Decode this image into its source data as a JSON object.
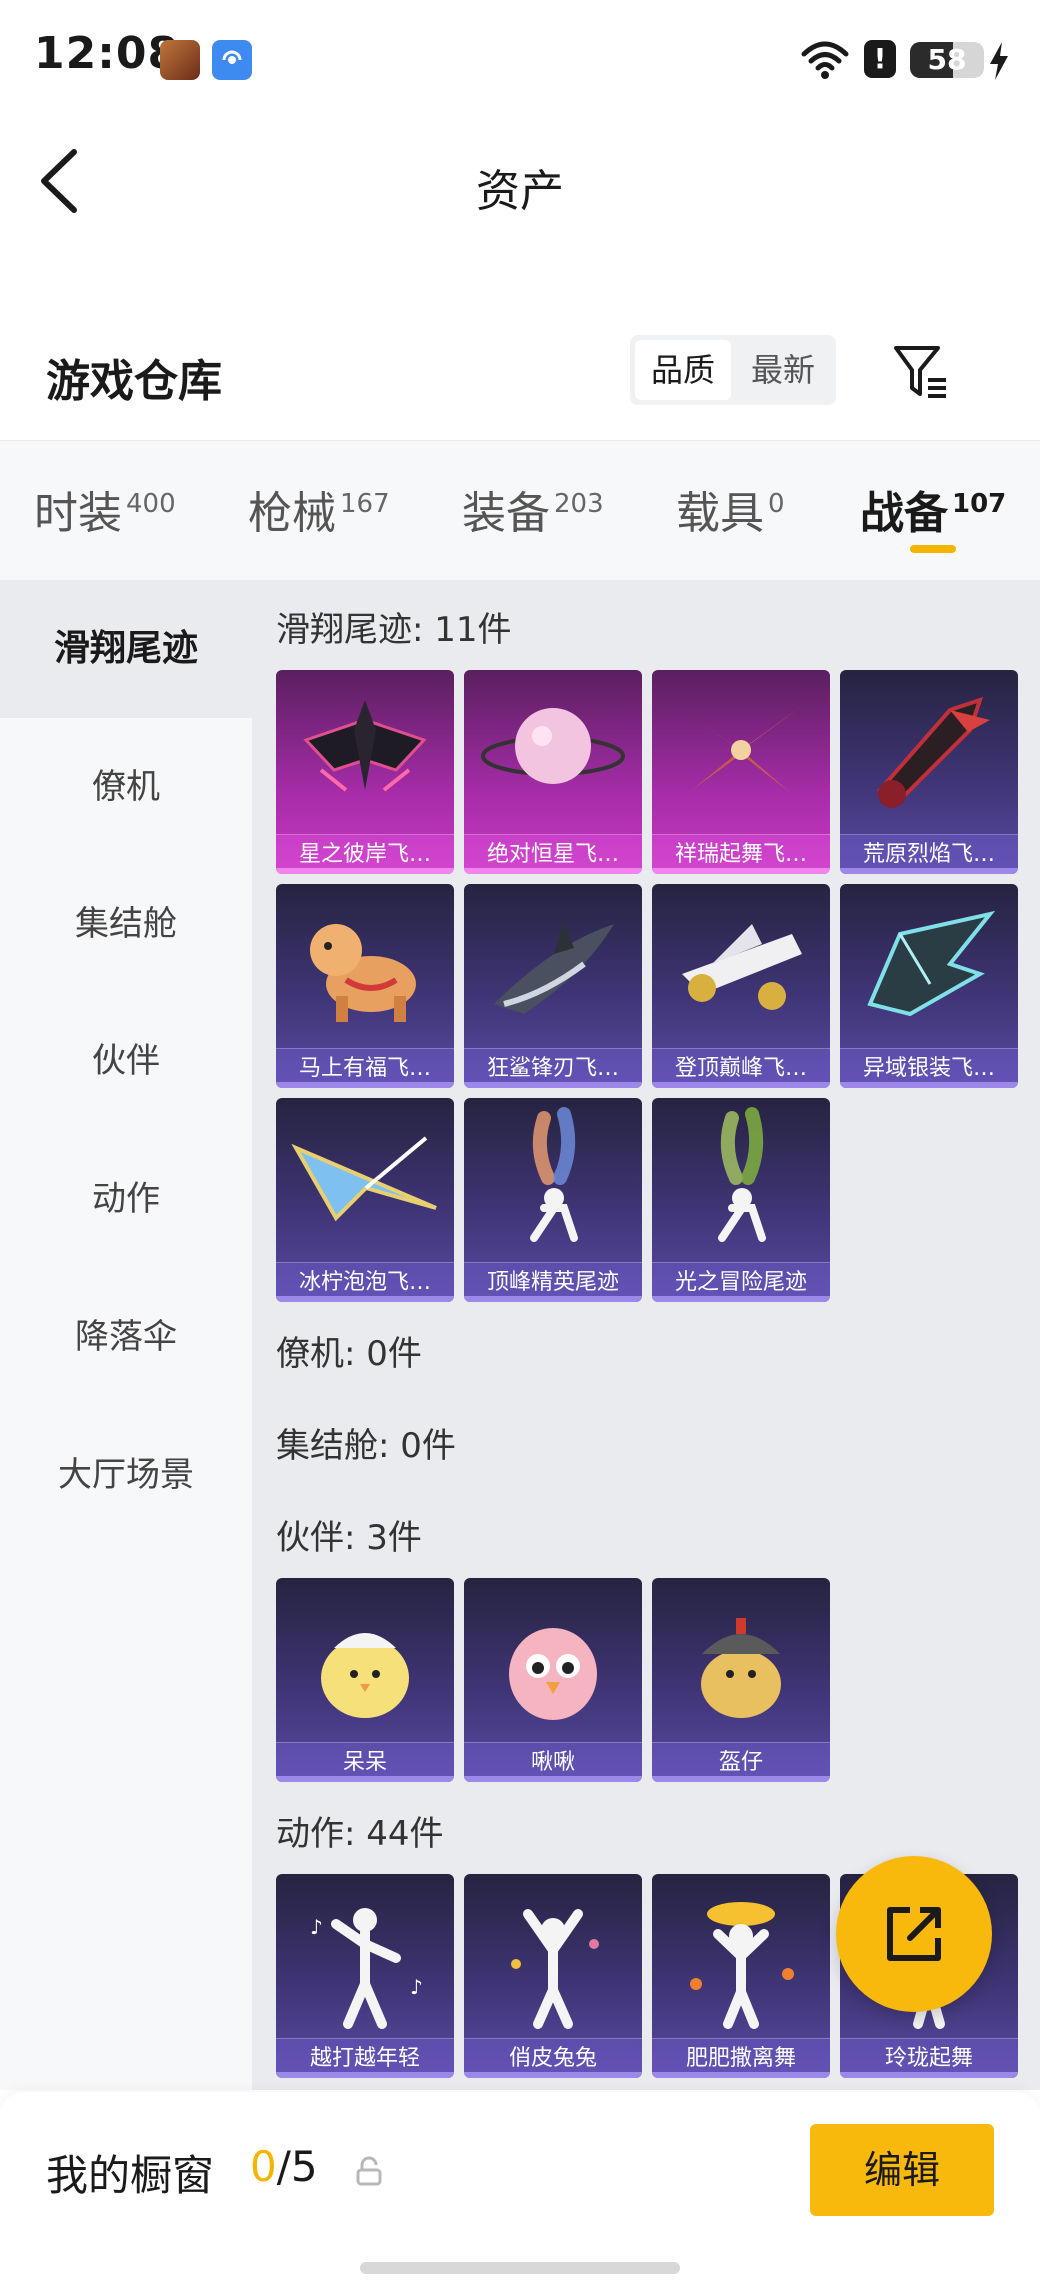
{
  "status_bar": {
    "time": "12:08",
    "battery_level": "58",
    "battery_fraction": 0.58,
    "icons": [
      "game-app-icon",
      "signal-app-icon",
      "wifi-icon",
      "alert-icon",
      "battery-icon",
      "charging-bolt-icon"
    ]
  },
  "header": {
    "title": "资产",
    "back_icon": "chevron-left-icon"
  },
  "warehouse": {
    "title": "游戏仓库",
    "sort_options": [
      "品质",
      "最新"
    ],
    "sort_selected": "品质",
    "filter_icon": "filter-icon"
  },
  "tabs": [
    {
      "label": "时装",
      "count": "400"
    },
    {
      "label": "枪械",
      "count": "167"
    },
    {
      "label": "装备",
      "count": "203"
    },
    {
      "label": "载具",
      "count": "0"
    },
    {
      "label": "战备",
      "count": "107",
      "active": true
    }
  ],
  "sidebar": [
    {
      "label": "滑翔尾迹",
      "active": true
    },
    {
      "label": "僚机"
    },
    {
      "label": "集结舱"
    },
    {
      "label": "伙伴"
    },
    {
      "label": "动作"
    },
    {
      "label": "降落伞"
    },
    {
      "label": "大厅场景"
    }
  ],
  "sections": [
    {
      "title": "滑翔尾迹: 11件",
      "items": [
        {
          "name": "星之彼岸飞…",
          "rarity": "legendary",
          "icon": "dark-glider-icon"
        },
        {
          "name": "绝对恒星飞…",
          "rarity": "legendary",
          "icon": "pink-planet-icon"
        },
        {
          "name": "祥瑞起舞飞…",
          "rarity": "legendary",
          "icon": "red-bird-glider-icon"
        },
        {
          "name": "荒原烈焰飞…",
          "rarity": "epic",
          "icon": "flame-glider-icon"
        },
        {
          "name": "马上有福飞…",
          "rarity": "epic",
          "icon": "horse-toy-icon"
        },
        {
          "name": "狂鲨锋刃飞…",
          "rarity": "epic",
          "icon": "shark-glider-icon"
        },
        {
          "name": "登顶巅峰飞…",
          "rarity": "epic",
          "icon": "white-jet-icon"
        },
        {
          "name": "异域银装飞…",
          "rarity": "epic",
          "icon": "silver-wing-icon"
        },
        {
          "name": "冰柠泡泡飞…",
          "rarity": "epic",
          "icon": "paper-plane-icon"
        },
        {
          "name": "顶峰精英尾迹",
          "rarity": "epic",
          "icon": "smoke-trail-icon"
        },
        {
          "name": "光之冒险尾迹",
          "rarity": "epic",
          "icon": "green-smoke-trail-icon"
        }
      ]
    },
    {
      "title": "僚机: 0件",
      "items": []
    },
    {
      "title": "集结舱: 0件",
      "items": []
    },
    {
      "title": "伙伴: 3件",
      "items": [
        {
          "name": "呆呆",
          "rarity": "epic",
          "icon": "chick-icon"
        },
        {
          "name": "啾啾",
          "rarity": "epic",
          "icon": "pink-bird-icon"
        },
        {
          "name": "盔仔",
          "rarity": "epic",
          "icon": "helmet-chick-icon"
        }
      ]
    },
    {
      "title": "动作: 44件",
      "items": [
        {
          "name": "越打越年轻",
          "rarity": "epic",
          "icon": "dance-pose-icon"
        },
        {
          "name": "俏皮兔兔",
          "rarity": "epic",
          "icon": "bunny-pose-icon"
        },
        {
          "name": "肥肥撒离舞",
          "rarity": "epic",
          "icon": "sparkle-dance-icon"
        },
        {
          "name": "玲珑起舞",
          "rarity": "epic",
          "icon": "graceful-dance-icon"
        }
      ]
    }
  ],
  "showcase": {
    "label": "我的橱窗",
    "used": "0",
    "total": "/5",
    "lock_icon": "lock-icon",
    "edit_label": "编辑"
  },
  "fab_icon": "share-external-icon",
  "colors": {
    "accent": "#f8b80c",
    "legendary": "#c93ac4",
    "epic": "#4a3e8e"
  }
}
